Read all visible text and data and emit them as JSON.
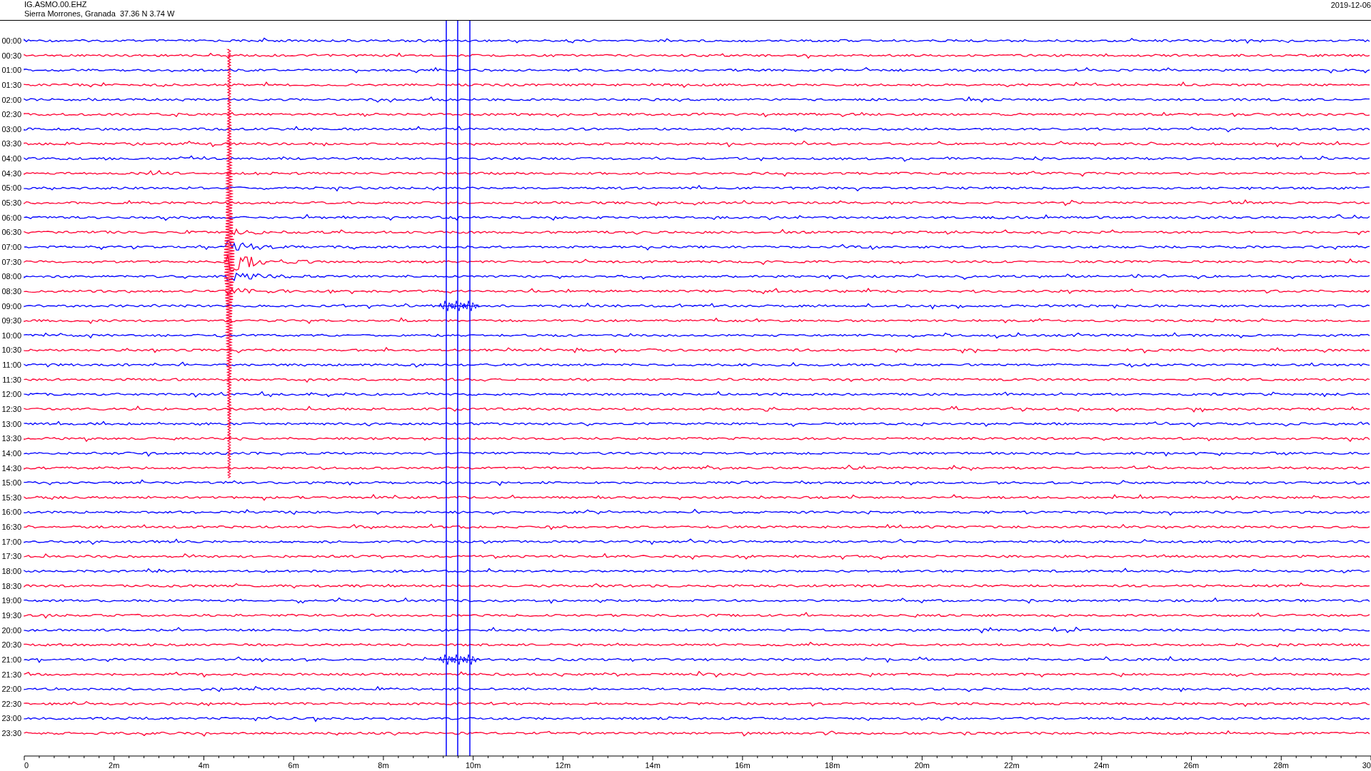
{
  "header": {
    "station": "IG.ASMO.00.EHZ",
    "location": "Sierra Morrones, Granada  37.36 N 3.74 W",
    "date": "2019-12-06"
  },
  "rows": [
    {
      "label": "00:00",
      "color": "#0000ff"
    },
    {
      "label": "00:30",
      "color": "#ff0033"
    },
    {
      "label": "01:00",
      "color": "#0000ff"
    },
    {
      "label": "01:30",
      "color": "#ff0033"
    },
    {
      "label": "02:00",
      "color": "#0000ff"
    },
    {
      "label": "02:30",
      "color": "#ff0033"
    },
    {
      "label": "03:00",
      "color": "#0000ff"
    },
    {
      "label": "03:30",
      "color": "#ff0033"
    },
    {
      "label": "04:00",
      "color": "#0000ff"
    },
    {
      "label": "04:30",
      "color": "#ff0033"
    },
    {
      "label": "05:00",
      "color": "#0000ff"
    },
    {
      "label": "05:30",
      "color": "#ff0033"
    },
    {
      "label": "06:00",
      "color": "#0000ff"
    },
    {
      "label": "06:30",
      "color": "#ff0033"
    },
    {
      "label": "07:00",
      "color": "#0000ff"
    },
    {
      "label": "07:30",
      "color": "#ff0033"
    },
    {
      "label": "08:00",
      "color": "#0000ff"
    },
    {
      "label": "08:30",
      "color": "#ff0033"
    },
    {
      "label": "09:00",
      "color": "#0000ff"
    },
    {
      "label": "09:30",
      "color": "#ff0033"
    },
    {
      "label": "10:00",
      "color": "#0000ff"
    },
    {
      "label": "10:30",
      "color": "#ff0033"
    },
    {
      "label": "11:00",
      "color": "#0000ff"
    },
    {
      "label": "11:30",
      "color": "#ff0033"
    },
    {
      "label": "12:00",
      "color": "#0000ff"
    },
    {
      "label": "12:30",
      "color": "#ff0033"
    },
    {
      "label": "13:00",
      "color": "#0000ff"
    },
    {
      "label": "13:30",
      "color": "#ff0033"
    },
    {
      "label": "14:00",
      "color": "#0000ff"
    },
    {
      "label": "14:30",
      "color": "#ff0033"
    },
    {
      "label": "15:00",
      "color": "#0000ff"
    },
    {
      "label": "15:30",
      "color": "#ff0033"
    },
    {
      "label": "16:00",
      "color": "#0000ff"
    },
    {
      "label": "16:30",
      "color": "#ff0033"
    },
    {
      "label": "17:00",
      "color": "#0000ff"
    },
    {
      "label": "17:30",
      "color": "#ff0033"
    },
    {
      "label": "18:00",
      "color": "#0000ff"
    },
    {
      "label": "18:30",
      "color": "#ff0033"
    },
    {
      "label": "19:00",
      "color": "#0000ff"
    },
    {
      "label": "19:30",
      "color": "#ff0033"
    },
    {
      "label": "20:00",
      "color": "#0000ff"
    },
    {
      "label": "20:30",
      "color": "#ff0033"
    },
    {
      "label": "21:00",
      "color": "#0000ff"
    },
    {
      "label": "21:30",
      "color": "#ff0033"
    },
    {
      "label": "22:00",
      "color": "#0000ff"
    },
    {
      "label": "22:30",
      "color": "#ff0033"
    },
    {
      "label": "23:00",
      "color": "#0000ff"
    },
    {
      "label": "23:30",
      "color": "#ff0033"
    }
  ],
  "x_axis": {
    "labels": [
      "0",
      "2m",
      "4m",
      "6m",
      "8m",
      "10m",
      "12m",
      "14m",
      "16m",
      "18m",
      "20m",
      "22m",
      "24m",
      "26m",
      "28m",
      "30"
    ]
  }
}
